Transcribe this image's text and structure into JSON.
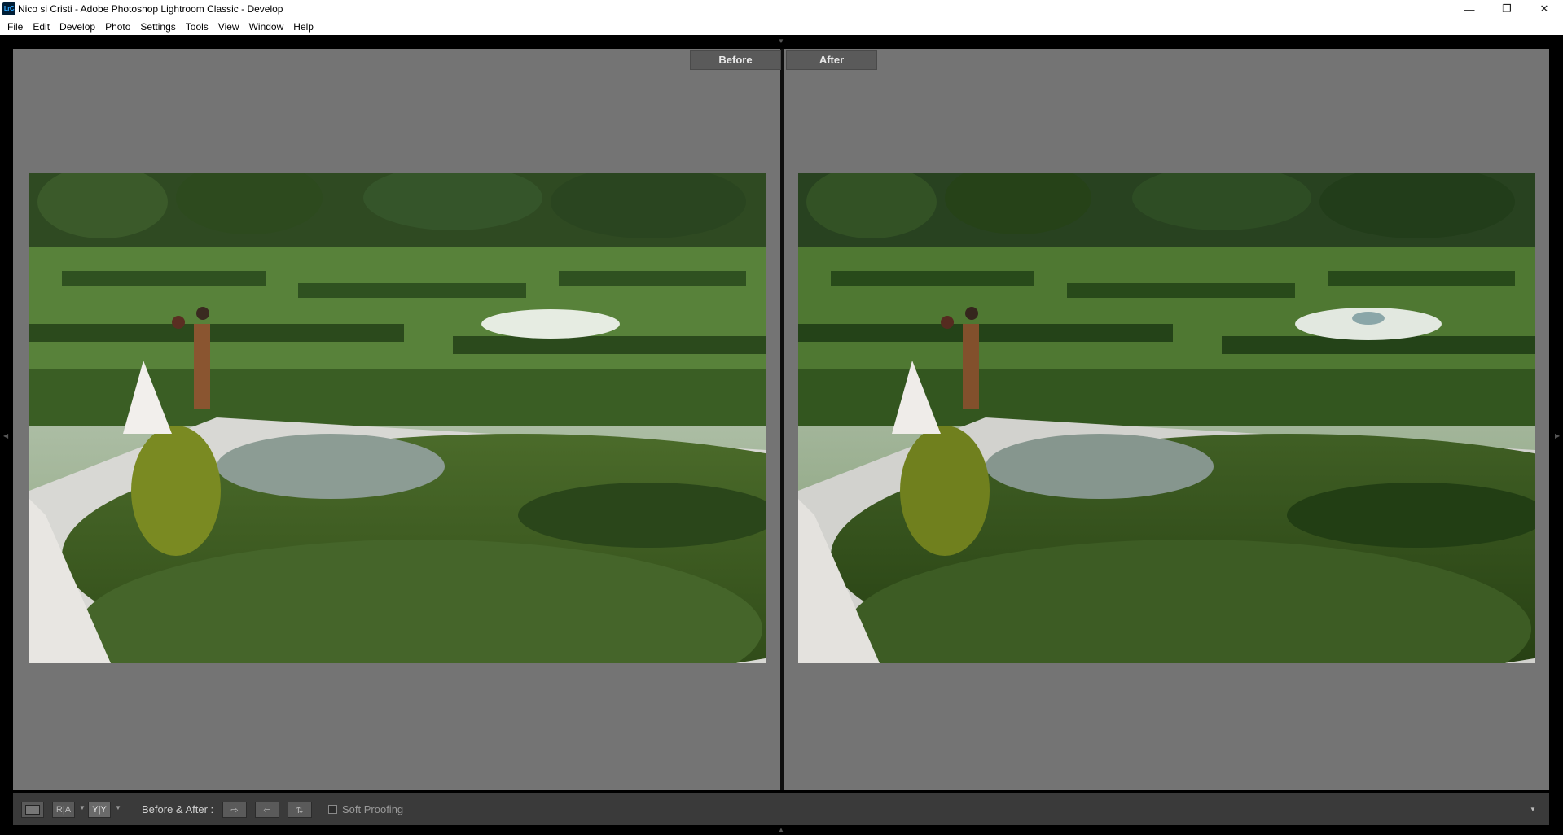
{
  "window": {
    "title": "Nico si Cristi - Adobe Photoshop Lightroom Classic - Develop",
    "app_icon_text": "LrC",
    "minimize_glyph": "—",
    "maximize_glyph": "❐",
    "close_glyph": "✕"
  },
  "menu": [
    "File",
    "Edit",
    "Develop",
    "Photo",
    "Settings",
    "Tools",
    "View",
    "Window",
    "Help"
  ],
  "compare": {
    "before_label": "Before",
    "after_label": "After"
  },
  "toolbar": {
    "loupe_icon": "loupe-view-icon",
    "ra_label": "R|A",
    "yy_label": "Y|Y",
    "before_after_label": "Before & After :",
    "soft_proofing_label": "Soft Proofing",
    "soft_proofing_checked": false
  },
  "colors": {
    "workarea": "#747474",
    "toolbar": "#3a3a3a",
    "label_bg": "#5a5a5a"
  }
}
